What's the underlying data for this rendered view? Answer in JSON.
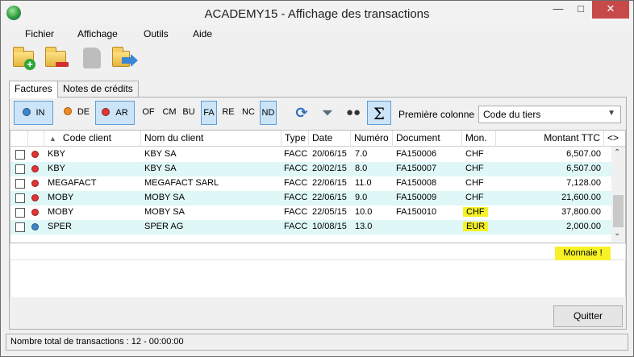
{
  "window": {
    "title": "ACADEMY15 - Affichage des transactions"
  },
  "menu": [
    "Fichier",
    "Affichage",
    "Outils",
    "Aide"
  ],
  "toolbar": [
    "add-folder-icon",
    "remove-folder-icon",
    "disabled-icon",
    "export-arrow-icon"
  ],
  "tabs": [
    {
      "label": "Factures",
      "active": true
    },
    {
      "label": "Notes de crédits",
      "active": false
    }
  ],
  "filters": [
    {
      "label": "IN",
      "dot": "#3b86c6",
      "pressed": true
    },
    {
      "label": "DE",
      "dot": "#f0891f",
      "pressed": false
    },
    {
      "label": "AR",
      "dot": "#e23434",
      "pressed": true
    },
    {
      "label": "OF",
      "pressed": false
    },
    {
      "label": "CM",
      "pressed": false
    },
    {
      "label": "BU",
      "pressed": false
    },
    {
      "label": "FA",
      "pressed": true
    },
    {
      "label": "RE",
      "pressed": false
    },
    {
      "label": "NC",
      "pressed": false
    },
    {
      "label": "ND",
      "pressed": true
    }
  ],
  "tools": [
    "refresh-icon",
    "filter-funnel-icon",
    "binoculars-icon",
    "sigma-icon"
  ],
  "first_column": {
    "label": "Première colonne",
    "value": "Code du tiers"
  },
  "grid": {
    "columns": [
      "Code client",
      "Nom du client",
      "Type",
      "Date",
      "Numéro",
      "Document",
      "Mon.",
      "Montant TTC",
      "<>"
    ],
    "rows": [
      {
        "status": "#e23434",
        "code": "KBY",
        "name": "KBY SA",
        "type": "FACC",
        "date": "20/06/15",
        "num": "7.0",
        "doc": "FA150006",
        "cur": "CHF",
        "amount": "6,507.00",
        "hl": false
      },
      {
        "status": "#e23434",
        "code": "KBY",
        "name": "KBY SA",
        "type": "FACC",
        "date": "20/02/15",
        "num": "8.0",
        "doc": "FA150007",
        "cur": "CHF",
        "amount": "6,507.00",
        "hl": false
      },
      {
        "status": "#e23434",
        "code": "MEGAFACT",
        "name": "MEGAFACT SARL",
        "type": "FACC",
        "date": "22/06/15",
        "num": "11.0",
        "doc": "FA150008",
        "cur": "CHF",
        "amount": "7,128.00",
        "hl": false
      },
      {
        "status": "#e23434",
        "code": "MOBY",
        "name": "MOBY SA",
        "type": "FACC",
        "date": "22/06/15",
        "num": "9.0",
        "doc": "FA150009",
        "cur": "CHF",
        "amount": "21,600.00",
        "hl": false
      },
      {
        "status": "#e23434",
        "code": "MOBY",
        "name": "MOBY SA",
        "type": "FACC",
        "date": "22/05/15",
        "num": "10.0",
        "doc": "FA150010",
        "cur": "CHF",
        "amount": "37,800.00",
        "hl": true
      },
      {
        "status": "#3b86c6",
        "code": "SPER",
        "name": "SPER AG",
        "type": "FACC",
        "date": "10/08/15",
        "num": "13.0",
        "doc": "",
        "cur": "EUR",
        "amount": "2,000.00",
        "hl": true
      }
    ]
  },
  "annotation": "Monnaie !",
  "quit_label": "Quitter",
  "status": "Nombre total de transactions : 12 - 00:00:00"
}
